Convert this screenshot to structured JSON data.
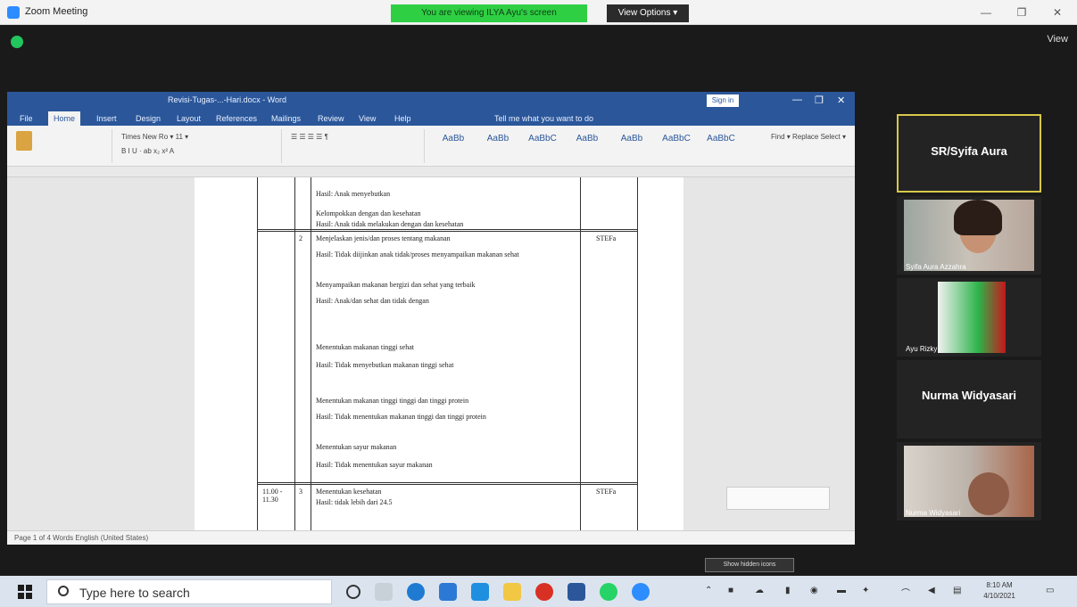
{
  "titlebar": {
    "title": "Zoom Meeting",
    "share_banner": "You are viewing ILYA Ayu's screen",
    "stop_share": "View Options ▾",
    "controls": [
      "—",
      "❐",
      "✕"
    ]
  },
  "meeting": {
    "view_label": "View"
  },
  "word": {
    "doc_name": "Revisi-Tugas-...-Hari.docx - Word",
    "account": "Sign in",
    "tabs": [
      "File",
      "Home",
      "Insert",
      "Design",
      "Layout",
      "References",
      "Mailings",
      "Review",
      "View",
      "Help",
      "Tell me what you want to do"
    ],
    "styles": [
      "AaBb",
      "AaBb",
      "AaBbC",
      "AaBb",
      "AaBb",
      "AaBbC",
      "AaBbC"
    ],
    "status": "Page 1 of 4   Words   English (United States)",
    "rows": [
      {
        "no": "",
        "time": "",
        "text": [
          "Hasil: Anak menyebutkan",
          "Kelompokkan dengan dan kesehatan",
          "Hasil: Anak tidak melakukan dengan dan kesehatan"
        ],
        "ttd": ""
      },
      {
        "no": "2",
        "time": "",
        "text": [
          "Menjelaskan jenis/dan proses tentang makanan",
          "Hasil: Tidak diijinkan anak tidak/proses menyampaikan makanan sehat",
          "Menyampaikan makanan bergizi dan sehat yang terbaik",
          "Hasil: Anak/dan sehat dan tidak dengan"
        ],
        "ttd": "STEFa"
      },
      {
        "no": "",
        "time": "",
        "text": [
          "Menentukan makanan tinggi sehat",
          "Hasil: Tidak menyebutkan makanan tinggi sehat"
        ],
        "ttd": ""
      },
      {
        "no": "",
        "time": "",
        "text": [
          "Menentukan makanan tinggi tinggi dan tinggi protein",
          "Hasil: Tidak menentukan makanan tinggi dan tinggi protein",
          "Menentukan sayur makanan",
          "Hasil: Tidak menentukan sayur makanan"
        ],
        "ttd": ""
      },
      {
        "no": "3",
        "time": "11.00 - 11.30",
        "text": [
          "Menentukan kesehatan",
          "Hasil: tidak lebih dari 24.5"
        ],
        "ttd": "STEFa"
      }
    ]
  },
  "participants": [
    {
      "name": "SR/Syifa Aura",
      "type": "name-only",
      "active": true
    },
    {
      "name": "Syifa Aura Azzahra",
      "type": "video"
    },
    {
      "name": "Ayu Rizky",
      "type": "video"
    },
    {
      "name": "Nurma Widyasari",
      "type": "name-only",
      "active": false
    },
    {
      "name": "Nurma Widyasari",
      "type": "video"
    }
  ],
  "tooltip": "Show hidden icons",
  "taskbar": {
    "search_placeholder": "Type here to search",
    "clock_time": "8:10 AM",
    "clock_date": "4/10/2021"
  }
}
